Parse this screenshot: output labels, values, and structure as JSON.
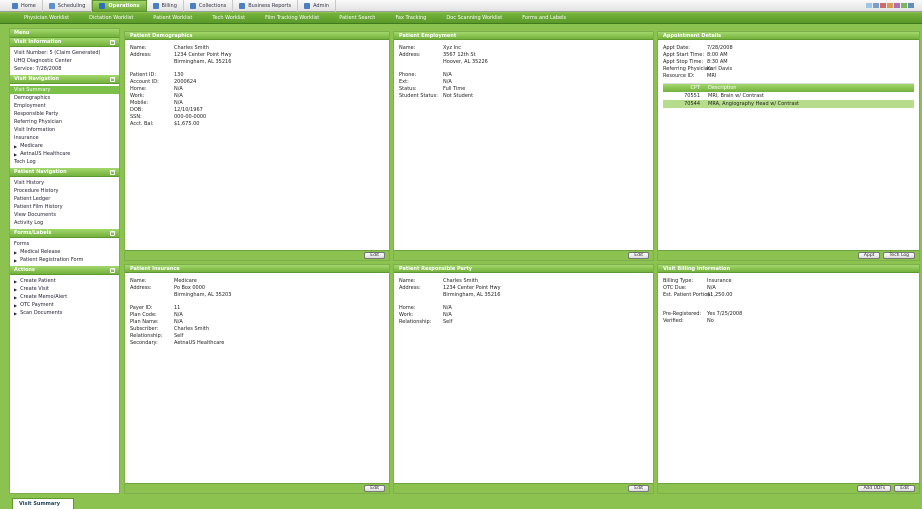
{
  "top_tabs": [
    {
      "label": "Home",
      "icon": "home-icon",
      "color": "#4a7fc1"
    },
    {
      "label": "Scheduling",
      "icon": "calendar-icon",
      "color": "#5a8fd0"
    },
    {
      "label": "Operations",
      "icon": "operations-icon",
      "color": "#2c6fb5",
      "active": true
    },
    {
      "label": "Billing",
      "icon": "billing-icon",
      "color": "#4a7fc1"
    },
    {
      "label": "Collections",
      "icon": "collections-icon",
      "color": "#4a7fc1"
    },
    {
      "label": "Business Reports",
      "icon": "reports-icon",
      "color": "#4a7fc1"
    },
    {
      "label": "Admin",
      "icon": "admin-icon",
      "color": "#4a7fc1"
    }
  ],
  "subnav": [
    "Physician Worklist",
    "Dictation Worklist",
    "Patient Worklist",
    "Tech Worklist",
    "Film Tracking Worklist",
    "Patient Search",
    "Fax Tracking",
    "Doc Scanning Worklist",
    "Forms and Labels"
  ],
  "sidebar": {
    "menu_title": "Menu",
    "visit_info": {
      "title": "Visit Information",
      "lines": [
        "Visit Number: 5 (Claim Generated)",
        "UHQ Diagnostic Center",
        "Service: 7/28/2008"
      ]
    },
    "visit_nav": {
      "title": "Visit Navigation",
      "items": [
        {
          "label": "Visit Summary",
          "selected": true
        },
        {
          "label": "Demographics"
        },
        {
          "label": "Employment"
        },
        {
          "label": "Responsible Party"
        },
        {
          "label": "Referring Physician"
        },
        {
          "label": "Visit Information"
        },
        {
          "label": "Insurance"
        },
        {
          "label": "Medicare",
          "arrow": true
        },
        {
          "label": "AetnaUS Healthcare",
          "arrow": true
        },
        {
          "label": "Tech Log"
        }
      ]
    },
    "patient_nav": {
      "title": "Patient Navigation",
      "items": [
        "Visit History",
        "Procedure History",
        "Patient Ledger",
        "Patient Film History",
        "View Documents",
        "Activity Log"
      ]
    },
    "forms": {
      "title": "Forms/Labels",
      "items": [
        {
          "label": "Forms"
        },
        {
          "label": "Medical Release",
          "arrow": true
        },
        {
          "label": "Patient Registration Form",
          "arrow": true
        }
      ]
    },
    "actions": {
      "title": "Actions",
      "items": [
        "Create Patient",
        "Create Visit",
        "Create Memo/Alert",
        "OTC Payment",
        "Scan Documents"
      ]
    }
  },
  "bottom_tab": "Visit Summary",
  "panels": {
    "demographics": {
      "title": "Patient Demographics",
      "edit": "Edit",
      "rows": [
        [
          "Name:",
          "Charles Smith"
        ],
        [
          "Address:",
          "1234 Center Point Hwy"
        ],
        [
          "",
          "Birmingham, AL 35216"
        ],
        [
          "",
          ""
        ],
        [
          "Patient ID:",
          "130"
        ],
        [
          "Account ID:",
          "2000624"
        ],
        [
          "Home:",
          "N/A"
        ],
        [
          "Work:",
          "N/A"
        ],
        [
          "Mobile:",
          "N/A"
        ],
        [
          "DOB:",
          "12/10/1967"
        ],
        [
          "SSN:",
          "000-00-0000"
        ],
        [
          "Acct. Bal:",
          "$1,675.00"
        ]
      ]
    },
    "employment": {
      "title": "Patient Employment",
      "edit": "Edit",
      "rows": [
        [
          "Name:",
          "Xyz Inc"
        ],
        [
          "Address:",
          "3567 12th St"
        ],
        [
          "",
          "Hoover, AL 35226"
        ],
        [
          "",
          ""
        ],
        [
          "Phone:",
          "N/A"
        ],
        [
          "Ext:",
          "N/A"
        ],
        [
          "Status:",
          "Full Time"
        ],
        [
          "Student Status:",
          "Not Student"
        ]
      ]
    },
    "appointment": {
      "title": "Appointment Details",
      "buttons": [
        "Appt",
        "Tech Log"
      ],
      "rows": [
        [
          "Appt Date:",
          "7/28/2008"
        ],
        [
          "Appt Start Time:",
          "8:00 AM"
        ],
        [
          "Appt Stop Time:",
          "8:30 AM"
        ],
        [
          "Referring Physician:",
          "Karl Davis"
        ],
        [
          "Resource ID:",
          "MRI"
        ]
      ],
      "cpt_header": [
        "CPT",
        "Description"
      ],
      "cpt_rows": [
        [
          "70551",
          "MRI, Brain w/ Contrast"
        ],
        [
          "70544",
          "MRA, Angiography Head w/ Contrast"
        ]
      ]
    },
    "insurance": {
      "title": "Patient Insurance",
      "edit": "Edit",
      "rows": [
        [
          "Name:",
          "Medicare"
        ],
        [
          "Address:",
          "Po Box 0000"
        ],
        [
          "",
          "Birmingham, AL 35203"
        ],
        [
          "",
          ""
        ],
        [
          "Payer ID:",
          "11"
        ],
        [
          "Plan Code:",
          "N/A"
        ],
        [
          "Plan Name:",
          "N/A"
        ],
        [
          "Subscriber:",
          "Charles Smith"
        ],
        [
          "Relationship:",
          "Self"
        ],
        [
          "Secondary:",
          "AetnaUS Healthcare"
        ]
      ]
    },
    "responsible": {
      "title": "Patient Responsible Party",
      "edit": "Edit",
      "rows": [
        [
          "Name:",
          "Charles Smith"
        ],
        [
          "Address:",
          "1234 Center Point Hwy"
        ],
        [
          "",
          "Birmingham, AL 35216"
        ],
        [
          "",
          ""
        ],
        [
          "Home:",
          "N/A"
        ],
        [
          "Work:",
          "N/A"
        ],
        [
          "Relationship:",
          "Self"
        ]
      ]
    },
    "billing": {
      "title": "Visit Billing Information",
      "buttons": [
        "Add UDFs",
        "Edit"
      ],
      "rows": [
        [
          "Billing Type:",
          "Insurance"
        ],
        [
          "OTC Due:",
          "N/A"
        ],
        [
          "Est. Patient Portion:",
          "$1,250.00"
        ],
        [
          "",
          ""
        ],
        [
          "",
          ""
        ],
        [
          "Pre-Registered:",
          "Yes 7/25/2008"
        ],
        [
          "Verified:",
          "No"
        ]
      ]
    }
  }
}
